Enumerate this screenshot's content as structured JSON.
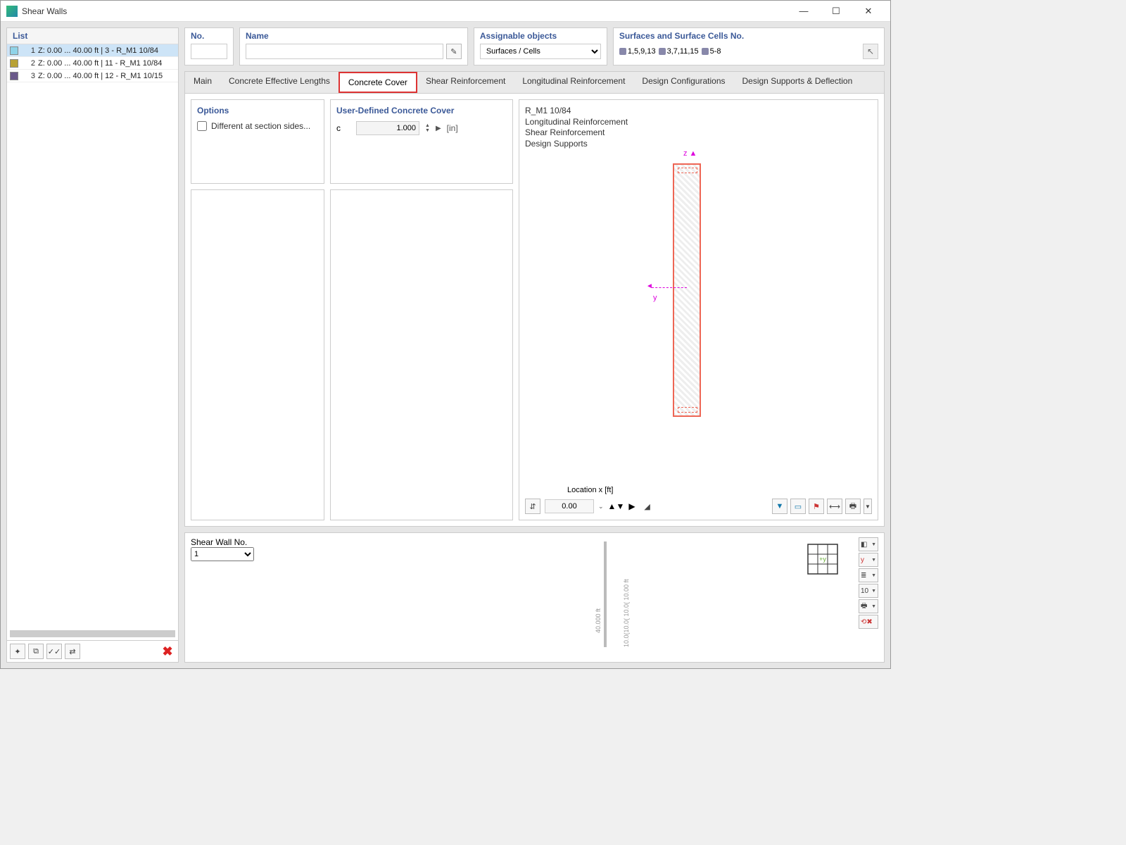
{
  "window": {
    "title": "Shear Walls"
  },
  "left": {
    "header": "List",
    "rows": [
      {
        "num": "1",
        "swatch": "#8fd3e8",
        "text": "Z: 0.00 ... 40.00 ft | 3 - R_M1 10/84",
        "selected": true
      },
      {
        "num": "2",
        "swatch": "#b8a135",
        "text": "Z: 0.00 ... 40.00 ft | 11 - R_M1 10/84",
        "selected": false
      },
      {
        "num": "3",
        "swatch": "#6b5a8a",
        "text": "Z: 0.00 ... 40.00 ft | 12 - R_M1 10/15",
        "selected": false
      }
    ]
  },
  "fields": {
    "no_label": "No.",
    "no_value": "",
    "name_label": "Name",
    "name_value": "",
    "assign_label": "Assignable objects",
    "assign_value": "Surfaces / Cells",
    "surf_label": "Surfaces and Surface Cells No.",
    "surf_groups": [
      "1,5,9,13",
      "3,7,11,15",
      "5-8"
    ]
  },
  "tabs": {
    "items": [
      "Main",
      "Concrete Effective Lengths",
      "Concrete Cover",
      "Shear Reinforcement",
      "Longitudinal Reinforcement",
      "Design Configurations",
      "Design Supports & Deflection"
    ],
    "active_index": 2
  },
  "options": {
    "title": "Options",
    "different_label": "Different at section sides..."
  },
  "cover": {
    "title": "User-Defined Concrete Cover",
    "symbol": "c",
    "value": "1.000",
    "unit": "[in]"
  },
  "preview": {
    "lines": [
      "R_M1 10/84",
      "Longitudinal Reinforcement",
      "Shear Reinforcement",
      "Design Supports"
    ],
    "axis_z": "z",
    "axis_y": "y",
    "location_label": "Location x [ft]",
    "location_value": "0.00"
  },
  "bottom": {
    "label": "Shear Wall No.",
    "selected": "1",
    "dim_text": "10.0(10.0( 10.0( 10.00 ft",
    "overall": "40.000 ft",
    "axis_tag": "+y"
  },
  "icons": {
    "new": "✦",
    "copy": "⧉",
    "checklist": "✓✓",
    "swap": "⇄",
    "close": "✖",
    "edit": "✎",
    "pick": "↖",
    "filter": "▾",
    "section": "▭",
    "flag": "⚑",
    "measure": "⟷",
    "print": "🖶",
    "cube": "◧",
    "axes": "↗",
    "layers": "≣",
    "num": "10",
    "magnify": "⌕"
  }
}
